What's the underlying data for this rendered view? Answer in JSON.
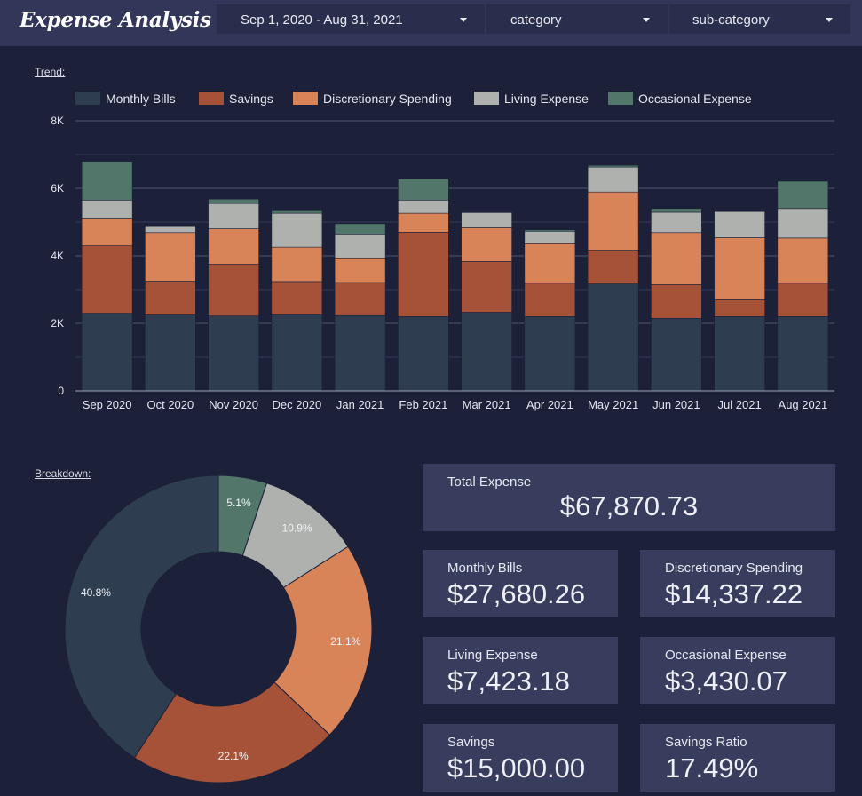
{
  "header": {
    "title": "Expense Analysis",
    "filters": {
      "date_range": "Sep 1, 2020 - Aug 31, 2021",
      "category": "category",
      "sub_category": "sub-category"
    }
  },
  "sections": {
    "trend_label": "Trend:",
    "breakdown_label": "Breakdown:"
  },
  "colors": {
    "monthly_bills": "#2e3d4f",
    "savings": "#a55238",
    "discretionary": "#d98458",
    "living": "#afb1ae",
    "occasional": "#52766a",
    "background": "#1c2038",
    "header": "#32375a",
    "card": "#383c5d"
  },
  "chart_data": [
    {
      "type": "bar",
      "stacked": true,
      "title": "",
      "categories": [
        "Sep 2020",
        "Oct 2020",
        "Nov 2020",
        "Dec 2020",
        "Jan 2021",
        "Feb 2021",
        "Mar 2021",
        "Apr 2021",
        "May 2021",
        "Jun 2021",
        "Jul 2021",
        "Aug 2021"
      ],
      "series": [
        {
          "name": "Monthly Bills",
          "color": "#2e3d4f",
          "values": [
            2300,
            2250,
            2220,
            2260,
            2230,
            2200,
            2330,
            2200,
            3170,
            2150,
            2200,
            2200
          ]
        },
        {
          "name": "Savings",
          "color": "#a55238",
          "values": [
            2000,
            1000,
            1530,
            980,
            980,
            2500,
            1500,
            990,
            1000,
            1000,
            500,
            990
          ]
        },
        {
          "name": "Discretionary Spending",
          "color": "#d98458",
          "values": [
            820,
            1440,
            1050,
            1020,
            730,
            560,
            1000,
            1170,
            1720,
            1540,
            1840,
            1340
          ]
        },
        {
          "name": "Living Expense",
          "color": "#afb1ae",
          "values": [
            530,
            200,
            750,
            1000,
            710,
            390,
            450,
            370,
            740,
            600,
            770,
            870
          ]
        },
        {
          "name": "Occasional Expense",
          "color": "#52766a",
          "values": [
            1150,
            0,
            130,
            100,
            300,
            630,
            0,
            40,
            50,
            110,
            0,
            810
          ]
        }
      ],
      "y_ticks": [
        "0",
        "2K",
        "4K",
        "6K",
        "8K"
      ],
      "ylim": [
        0,
        8000
      ],
      "legend_position": "top",
      "grid": true
    },
    {
      "type": "pie",
      "donut": true,
      "slices": [
        {
          "label": "Occasional Expense",
          "percent": 5.1,
          "display": "5.1%",
          "color": "#52766a"
        },
        {
          "label": "Living Expense",
          "percent": 10.9,
          "display": "10.9%",
          "color": "#afb1ae"
        },
        {
          "label": "Discretionary Spending",
          "percent": 21.1,
          "display": "21.1%",
          "color": "#d98458"
        },
        {
          "label": "Savings",
          "percent": 22.1,
          "display": "22.1%",
          "color": "#a55238"
        },
        {
          "label": "Monthly Bills",
          "percent": 40.8,
          "display": "40.8%",
          "color": "#2e3d4f"
        }
      ]
    }
  ],
  "kpis": {
    "total": {
      "label": "Total Expense",
      "value": "$67,870.73"
    },
    "monthly_bills": {
      "label": "Monthly Bills",
      "value": "$27,680.26"
    },
    "discretionary": {
      "label": "Discretionary Spending",
      "value": "$14,337.22"
    },
    "living": {
      "label": "Living Expense",
      "value": "$7,423.18"
    },
    "occasional": {
      "label": "Occasional Expense",
      "value": "$3,430.07"
    },
    "savings": {
      "label": "Savings",
      "value": "$15,000.00"
    },
    "savings_ratio": {
      "label": "Savings Ratio",
      "value": "17.49%"
    }
  }
}
